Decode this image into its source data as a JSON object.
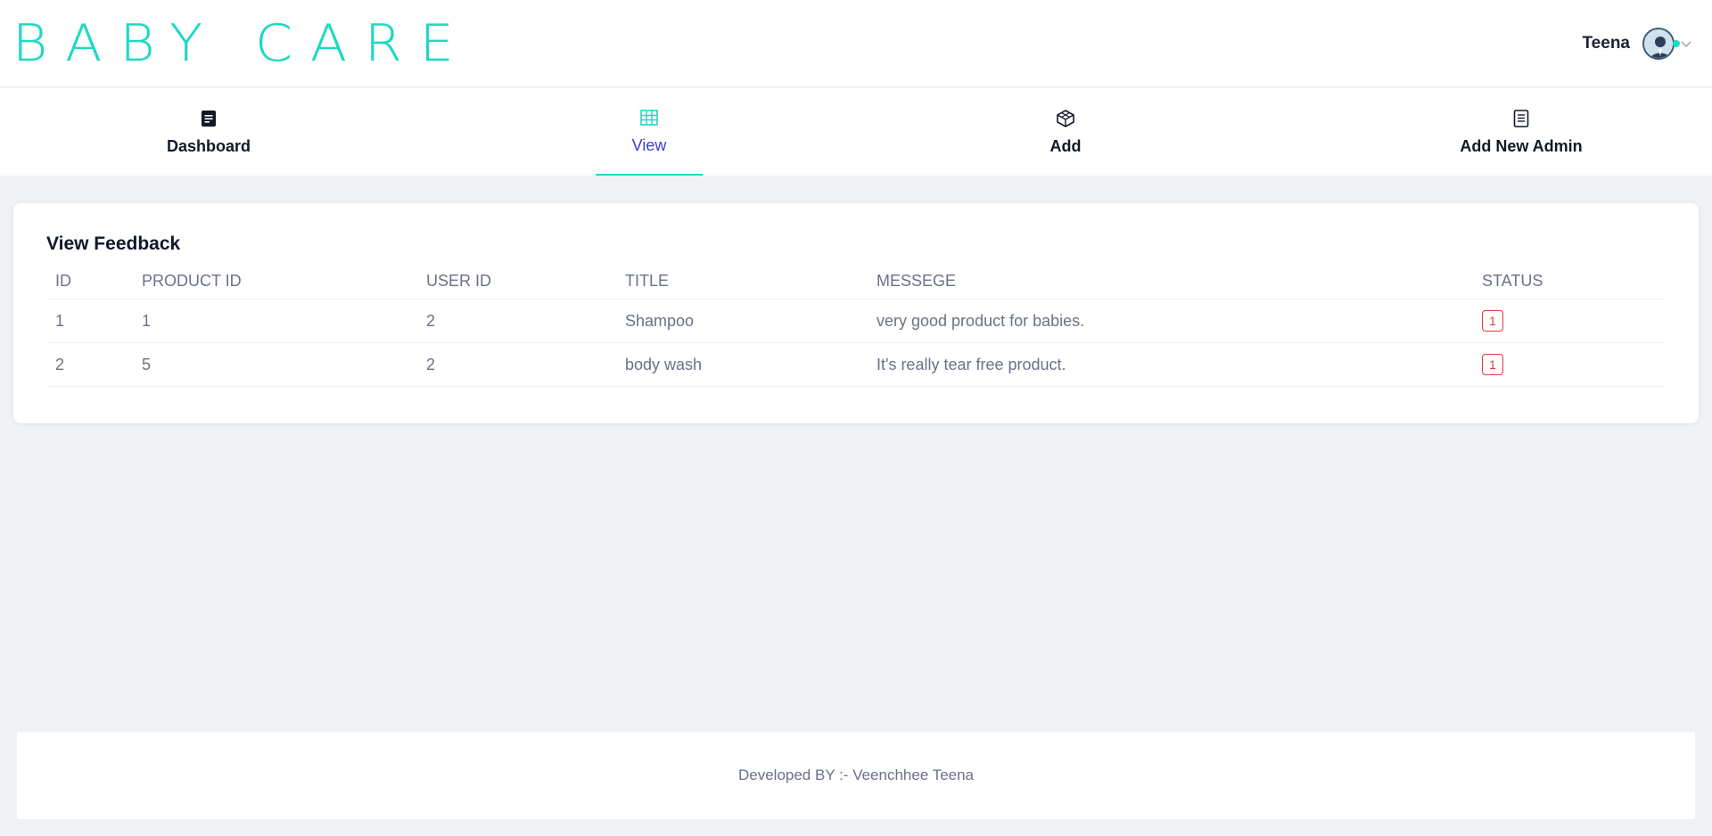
{
  "brand": {
    "logo_text": "BABY CARE",
    "accent": "#1fd8c4"
  },
  "user": {
    "name": "Teena",
    "avatar_icon": "user-avatar-icon",
    "menu_icon": "chevron-down-icon"
  },
  "nav": {
    "items": [
      {
        "label": "Dashboard",
        "icon": "document-icon",
        "active": false
      },
      {
        "label": "View",
        "icon": "grid-icon",
        "active": true
      },
      {
        "label": "Add",
        "icon": "cube-icon",
        "active": false
      },
      {
        "label": "Add New Admin",
        "icon": "file-lines-icon",
        "active": false
      }
    ]
  },
  "feedback": {
    "title": "View Feedback",
    "columns": [
      "ID",
      "PRODUCT ID",
      "USER ID",
      "TITLE",
      "MESSEGE",
      "STATUS"
    ],
    "rows": [
      {
        "id": "1",
        "product_id": "1",
        "user_id": "2",
        "title": "Shampoo",
        "message": "very good product for babies.",
        "status": "1"
      },
      {
        "id": "2",
        "product_id": "5",
        "user_id": "2",
        "title": "body wash",
        "message": "It's really tear free product.",
        "status": "1"
      }
    ]
  },
  "footer": {
    "text": "Developed BY :- Veenchhee Teena"
  },
  "colors": {
    "status_badge": "#e03a3a",
    "active_nav_text": "#3b3fd8"
  }
}
